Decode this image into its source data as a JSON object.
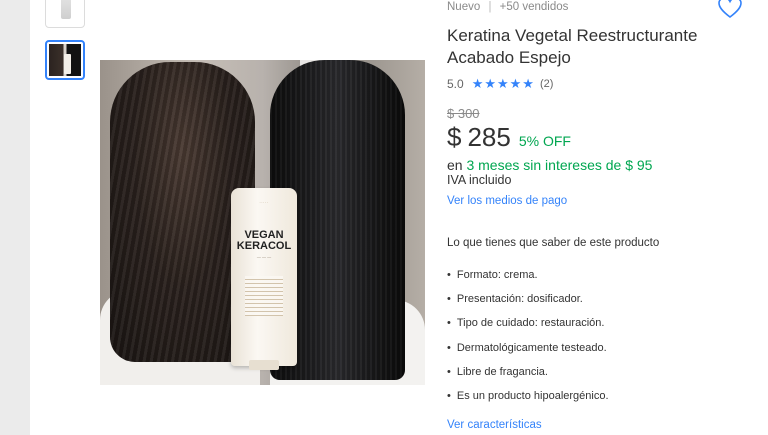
{
  "product": {
    "condition": "Nuevo",
    "separator": "|",
    "sold": "+50 vendidos",
    "title": "Keratina Vegetal Reestructurante Acabado Espejo",
    "rating_value": "5.0",
    "stars": "★★★★★",
    "rating_count": "(2)",
    "old_price": "$ 300",
    "currency": "$",
    "price": "285",
    "discount": "5% OFF",
    "installments_prefix": "en",
    "installments": "3 meses sin intereses de $ 95",
    "tax": "IVA incluido",
    "payment_link": "Ver los medios de pago",
    "tube_name": "VEGAN KERACOL"
  },
  "features": {
    "heading": "Lo que tienes que saber de este producto",
    "items": [
      "Formato: crema.",
      "Presentación: dosificador.",
      "Tipo de cuidado: restauración.",
      "Dermatológicamente testeado.",
      "Libre de fragancia.",
      "Es un producto hipoalergénico."
    ],
    "more_link": "Ver características"
  },
  "colors": {
    "accent": "#3483fa",
    "discount": "#00a650",
    "text": "#333333",
    "muted": "#8a8a8a",
    "page_bg": "#ebebeb"
  },
  "icons": {
    "favorite": "heart-icon",
    "rating": "star-icon"
  }
}
